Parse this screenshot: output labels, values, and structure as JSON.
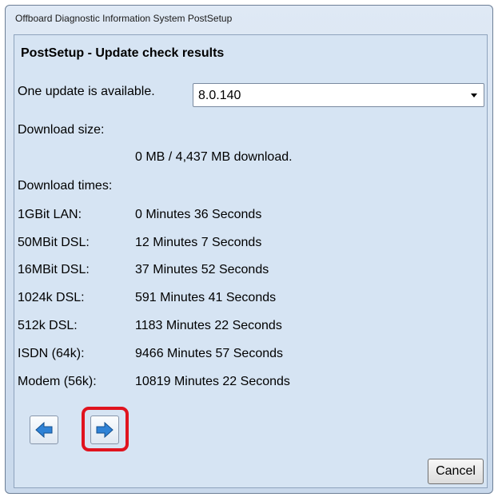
{
  "window": {
    "title": "Offboard Diagnostic Information System PostSetup"
  },
  "heading": "PostSetup - Update check results",
  "update": {
    "label": "One update is available.",
    "selected_version": "8.0.140"
  },
  "download_size": {
    "label": "Download size:",
    "value": "0 MB / 4,437 MB download."
  },
  "download_times": {
    "label": "Download times:",
    "rows": [
      {
        "connection": "1GBit LAN:",
        "time": "0 Minutes 36 Seconds"
      },
      {
        "connection": "50MBit DSL:",
        "time": "12 Minutes 7 Seconds"
      },
      {
        "connection": "16MBit DSL:",
        "time": "37 Minutes 52 Seconds"
      },
      {
        "connection": "1024k DSL:",
        "time": "591 Minutes 41 Seconds"
      },
      {
        "connection": "512k DSL:",
        "time": "1183 Minutes 22 Seconds"
      },
      {
        "connection": "ISDN (64k):",
        "time": "9466 Minutes 57 Seconds"
      },
      {
        "connection": "Modem (56k):",
        "time": "10819 Minutes 22 Seconds"
      }
    ]
  },
  "buttons": {
    "cancel_label": "Cancel"
  },
  "colors": {
    "highlight": "#e0131e",
    "arrow": "#2f82d6",
    "background": "#d6e4f3"
  }
}
